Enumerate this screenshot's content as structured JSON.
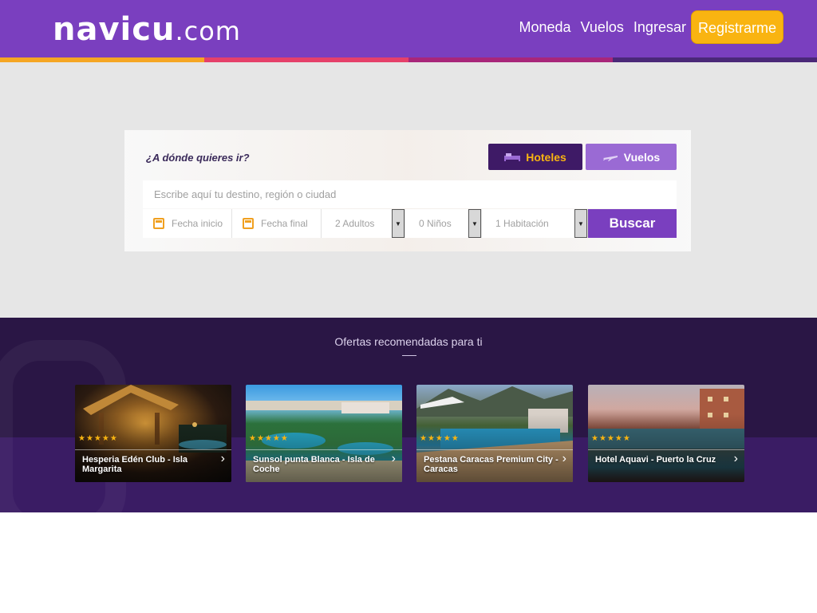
{
  "header": {
    "logo_main": "navicu",
    "logo_suffix": ".com",
    "nav": [
      "Moneda",
      "Vuelos",
      "Ingresar"
    ],
    "register_label": "Registrarme",
    "color_bar": [
      "#f5a623",
      "#e5406a",
      "#a8267a",
      "#4a2878"
    ]
  },
  "search": {
    "question": "¿A dónde quieres ir?",
    "tabs": {
      "hotels": "Hoteles",
      "flights": "Vuelos"
    },
    "destination_placeholder": "Escribe aquí tu destino, región o ciudad",
    "checkin_placeholder": "Fecha inicio",
    "checkout_placeholder": "Fecha final",
    "adults": "2 Adultos",
    "children": "0 Niños",
    "rooms": "1 Habitación",
    "search_label": "Buscar"
  },
  "offers": {
    "title": "Ofertas recomendadas para ti",
    "items": [
      {
        "name": "Hesperia Edén Club - Isla Margarita",
        "stars": "★★★★★"
      },
      {
        "name": "Sunsol punta Blanca - Isla de Coche",
        "stars": "★★★★★"
      },
      {
        "name": "Pestana Caracas Premium City - Caracas",
        "stars": "★★★★★"
      },
      {
        "name": "Hotel Aquavi - Puerto la Cruz",
        "stars": "★★★★★"
      }
    ]
  },
  "colors": {
    "primary": "#7a3fbf",
    "accent": "#f9b411",
    "dark": "#2a1645"
  }
}
